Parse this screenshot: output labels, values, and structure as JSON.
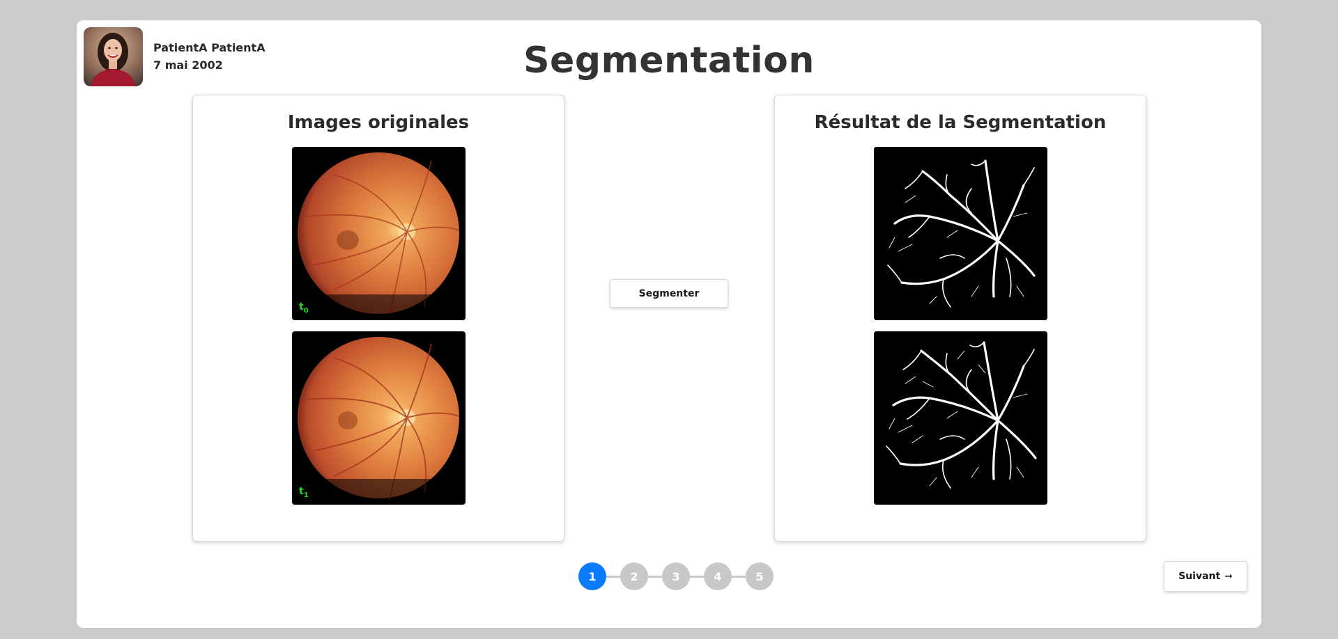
{
  "patient": {
    "name": "PatientA PatientA",
    "birthdate": "7 mai 2002"
  },
  "page": {
    "title": "Segmentation"
  },
  "originals": {
    "title": "Images originales",
    "images": [
      {
        "label_base": "t",
        "label_sub": "0"
      },
      {
        "label_base": "t",
        "label_sub": "1"
      }
    ]
  },
  "result": {
    "title": "Résultat de la Segmentation"
  },
  "actions": {
    "segment_label": "Segmenter",
    "next_label": "Suivant",
    "next_icon": "arrow-right-icon"
  },
  "stepper": {
    "steps": [
      "1",
      "2",
      "3",
      "4",
      "5"
    ],
    "active_step": "1"
  },
  "colors": {
    "accent": "#0a7cff",
    "inactive_step": "#c8c8c8",
    "time_label": "#19e019",
    "page_background": "#cbcbcb"
  }
}
